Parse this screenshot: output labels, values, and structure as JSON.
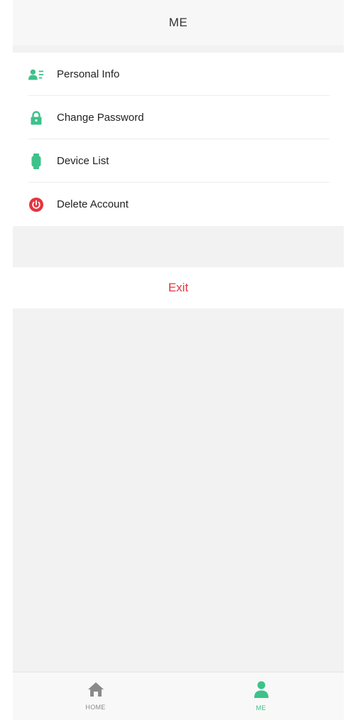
{
  "header": {
    "title": "ME"
  },
  "menu": {
    "items": [
      {
        "label": "Personal Info",
        "icon": "person-card-icon"
      },
      {
        "label": "Change Password",
        "icon": "lock-icon"
      },
      {
        "label": "Device List",
        "icon": "watch-icon"
      },
      {
        "label": "Delete Account",
        "icon": "power-icon"
      }
    ]
  },
  "exit": {
    "label": "Exit"
  },
  "tabbar": {
    "tabs": [
      {
        "label": "HOME",
        "icon": "home-icon",
        "active": false
      },
      {
        "label": "ME",
        "icon": "person-icon",
        "active": true
      }
    ]
  },
  "colors": {
    "accent_green": "#3cc28a",
    "danger_red": "#e5343f",
    "inactive_gray": "#8a8a8a",
    "background": "#f2f2f2"
  }
}
